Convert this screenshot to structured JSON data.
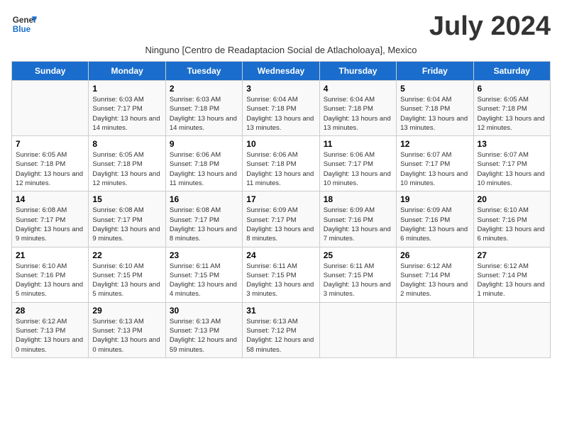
{
  "logo": {
    "line1": "General",
    "line2": "Blue"
  },
  "title": "July 2024",
  "subtitle": "Ninguno [Centro de Readaptacion Social de Atlacholoaya], Mexico",
  "days_of_week": [
    "Sunday",
    "Monday",
    "Tuesday",
    "Wednesday",
    "Thursday",
    "Friday",
    "Saturday"
  ],
  "weeks": [
    [
      {
        "day": "",
        "sunrise": "",
        "sunset": "",
        "daylight": ""
      },
      {
        "day": "1",
        "sunrise": "Sunrise: 6:03 AM",
        "sunset": "Sunset: 7:17 PM",
        "daylight": "Daylight: 13 hours and 14 minutes."
      },
      {
        "day": "2",
        "sunrise": "Sunrise: 6:03 AM",
        "sunset": "Sunset: 7:18 PM",
        "daylight": "Daylight: 13 hours and 14 minutes."
      },
      {
        "day": "3",
        "sunrise": "Sunrise: 6:04 AM",
        "sunset": "Sunset: 7:18 PM",
        "daylight": "Daylight: 13 hours and 13 minutes."
      },
      {
        "day": "4",
        "sunrise": "Sunrise: 6:04 AM",
        "sunset": "Sunset: 7:18 PM",
        "daylight": "Daylight: 13 hours and 13 minutes."
      },
      {
        "day": "5",
        "sunrise": "Sunrise: 6:04 AM",
        "sunset": "Sunset: 7:18 PM",
        "daylight": "Daylight: 13 hours and 13 minutes."
      },
      {
        "day": "6",
        "sunrise": "Sunrise: 6:05 AM",
        "sunset": "Sunset: 7:18 PM",
        "daylight": "Daylight: 13 hours and 12 minutes."
      }
    ],
    [
      {
        "day": "7",
        "sunrise": "Sunrise: 6:05 AM",
        "sunset": "Sunset: 7:18 PM",
        "daylight": "Daylight: 13 hours and 12 minutes."
      },
      {
        "day": "8",
        "sunrise": "Sunrise: 6:05 AM",
        "sunset": "Sunset: 7:18 PM",
        "daylight": "Daylight: 13 hours and 12 minutes."
      },
      {
        "day": "9",
        "sunrise": "Sunrise: 6:06 AM",
        "sunset": "Sunset: 7:18 PM",
        "daylight": "Daylight: 13 hours and 11 minutes."
      },
      {
        "day": "10",
        "sunrise": "Sunrise: 6:06 AM",
        "sunset": "Sunset: 7:18 PM",
        "daylight": "Daylight: 13 hours and 11 minutes."
      },
      {
        "day": "11",
        "sunrise": "Sunrise: 6:06 AM",
        "sunset": "Sunset: 7:17 PM",
        "daylight": "Daylight: 13 hours and 10 minutes."
      },
      {
        "day": "12",
        "sunrise": "Sunrise: 6:07 AM",
        "sunset": "Sunset: 7:17 PM",
        "daylight": "Daylight: 13 hours and 10 minutes."
      },
      {
        "day": "13",
        "sunrise": "Sunrise: 6:07 AM",
        "sunset": "Sunset: 7:17 PM",
        "daylight": "Daylight: 13 hours and 10 minutes."
      }
    ],
    [
      {
        "day": "14",
        "sunrise": "Sunrise: 6:08 AM",
        "sunset": "Sunset: 7:17 PM",
        "daylight": "Daylight: 13 hours and 9 minutes."
      },
      {
        "day": "15",
        "sunrise": "Sunrise: 6:08 AM",
        "sunset": "Sunset: 7:17 PM",
        "daylight": "Daylight: 13 hours and 9 minutes."
      },
      {
        "day": "16",
        "sunrise": "Sunrise: 6:08 AM",
        "sunset": "Sunset: 7:17 PM",
        "daylight": "Daylight: 13 hours and 8 minutes."
      },
      {
        "day": "17",
        "sunrise": "Sunrise: 6:09 AM",
        "sunset": "Sunset: 7:17 PM",
        "daylight": "Daylight: 13 hours and 8 minutes."
      },
      {
        "day": "18",
        "sunrise": "Sunrise: 6:09 AM",
        "sunset": "Sunset: 7:16 PM",
        "daylight": "Daylight: 13 hours and 7 minutes."
      },
      {
        "day": "19",
        "sunrise": "Sunrise: 6:09 AM",
        "sunset": "Sunset: 7:16 PM",
        "daylight": "Daylight: 13 hours and 6 minutes."
      },
      {
        "day": "20",
        "sunrise": "Sunrise: 6:10 AM",
        "sunset": "Sunset: 7:16 PM",
        "daylight": "Daylight: 13 hours and 6 minutes."
      }
    ],
    [
      {
        "day": "21",
        "sunrise": "Sunrise: 6:10 AM",
        "sunset": "Sunset: 7:16 PM",
        "daylight": "Daylight: 13 hours and 5 minutes."
      },
      {
        "day": "22",
        "sunrise": "Sunrise: 6:10 AM",
        "sunset": "Sunset: 7:15 PM",
        "daylight": "Daylight: 13 hours and 5 minutes."
      },
      {
        "day": "23",
        "sunrise": "Sunrise: 6:11 AM",
        "sunset": "Sunset: 7:15 PM",
        "daylight": "Daylight: 13 hours and 4 minutes."
      },
      {
        "day": "24",
        "sunrise": "Sunrise: 6:11 AM",
        "sunset": "Sunset: 7:15 PM",
        "daylight": "Daylight: 13 hours and 3 minutes."
      },
      {
        "day": "25",
        "sunrise": "Sunrise: 6:11 AM",
        "sunset": "Sunset: 7:15 PM",
        "daylight": "Daylight: 13 hours and 3 minutes."
      },
      {
        "day": "26",
        "sunrise": "Sunrise: 6:12 AM",
        "sunset": "Sunset: 7:14 PM",
        "daylight": "Daylight: 13 hours and 2 minutes."
      },
      {
        "day": "27",
        "sunrise": "Sunrise: 6:12 AM",
        "sunset": "Sunset: 7:14 PM",
        "daylight": "Daylight: 13 hours and 1 minute."
      }
    ],
    [
      {
        "day": "28",
        "sunrise": "Sunrise: 6:12 AM",
        "sunset": "Sunset: 7:13 PM",
        "daylight": "Daylight: 13 hours and 0 minutes."
      },
      {
        "day": "29",
        "sunrise": "Sunrise: 6:13 AM",
        "sunset": "Sunset: 7:13 PM",
        "daylight": "Daylight: 13 hours and 0 minutes."
      },
      {
        "day": "30",
        "sunrise": "Sunrise: 6:13 AM",
        "sunset": "Sunset: 7:13 PM",
        "daylight": "Daylight: 12 hours and 59 minutes."
      },
      {
        "day": "31",
        "sunrise": "Sunrise: 6:13 AM",
        "sunset": "Sunset: 7:12 PM",
        "daylight": "Daylight: 12 hours and 58 minutes."
      },
      {
        "day": "",
        "sunrise": "",
        "sunset": "",
        "daylight": ""
      },
      {
        "day": "",
        "sunrise": "",
        "sunset": "",
        "daylight": ""
      },
      {
        "day": "",
        "sunrise": "",
        "sunset": "",
        "daylight": ""
      }
    ]
  ]
}
